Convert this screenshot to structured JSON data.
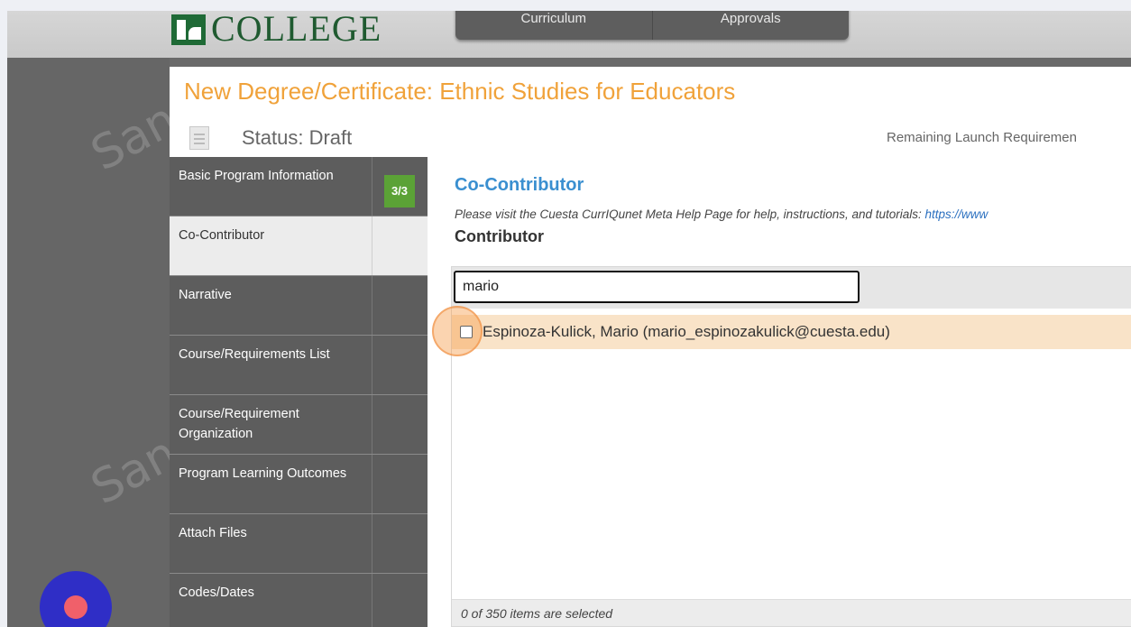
{
  "header": {
    "logo_text": "COLLEGE",
    "tabs": [
      {
        "label": "Curriculum"
      },
      {
        "label": "Approvals"
      }
    ]
  },
  "watermark": {
    "text": "San"
  },
  "page": {
    "title": "New Degree/Certificate: Ethnic Studies for Educators",
    "status": "Status: Draft",
    "launch_requirements": "Remaining Launch Requiremen"
  },
  "sidebar": {
    "items": [
      {
        "label": "Basic Program Information",
        "badge": "3/3"
      },
      {
        "label": "Co-Contributor"
      },
      {
        "label": "Narrative"
      },
      {
        "label": "Course/Requirements List"
      },
      {
        "label": "Course/Requirement Organization"
      },
      {
        "label": "Program Learning Outcomes"
      },
      {
        "label": "Attach Files"
      },
      {
        "label": "Codes/Dates"
      }
    ]
  },
  "section": {
    "title": "Co-Contributor",
    "help_text": "Please visit the Cuesta CurrIQunet Meta Help Page for help, instructions, and tutorials: ",
    "help_link": "https://www",
    "contributor_label": "Contributor",
    "search_value": "mario",
    "results": [
      {
        "label": "Espinoza-Kulick, Mario (mario_espinozakulick@cuesta.edu)",
        "checked": false
      }
    ],
    "footer": "0 of 350 items are selected"
  },
  "colors": {
    "title": "#f0a23a",
    "section_title": "#3a8fd0",
    "badge": "#5ba236",
    "highlight_row": "#f9e3c8"
  }
}
